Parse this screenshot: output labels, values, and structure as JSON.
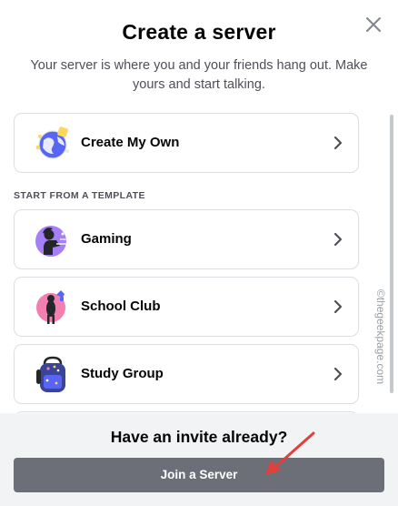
{
  "modal": {
    "title": "Create a server",
    "subtitle": "Your server is where you and your friends hang out. Make yours and start talking.",
    "close_icon": "close-icon"
  },
  "create_own": {
    "label": "Create My Own",
    "icon": "create-own-globe-icon"
  },
  "templates": {
    "section_label": "START FROM A TEMPLATE",
    "items": [
      {
        "label": "Gaming",
        "icon": "gaming-icon",
        "color": "#a67ef6"
      },
      {
        "label": "School Club",
        "icon": "school-club-icon",
        "color": "#f37fb1"
      },
      {
        "label": "Study Group",
        "icon": "study-group-icon",
        "color": "#c9cbe9"
      }
    ]
  },
  "footer": {
    "title": "Have an invite already?",
    "join_button": "Join a Server",
    "button_color": "#6d6f78"
  },
  "watermark": "©thegeekpage.com",
  "annotation_arrow_color": "#e2403c"
}
